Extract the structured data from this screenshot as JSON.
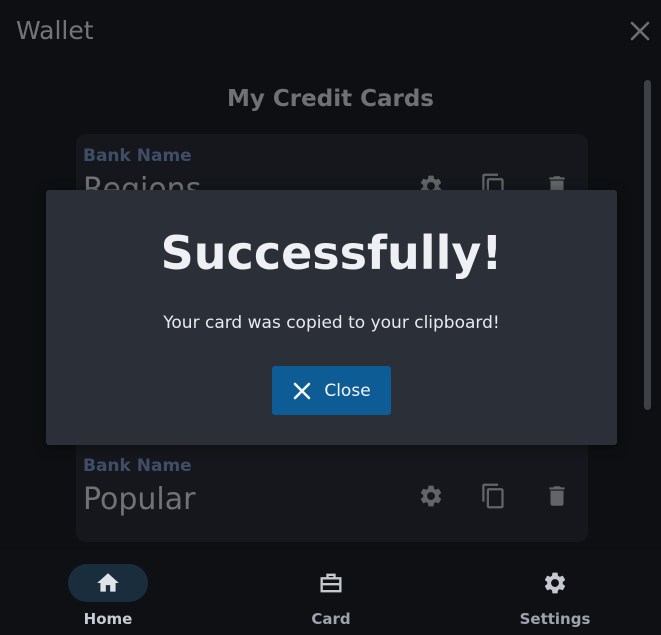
{
  "window": {
    "title": "Wallet",
    "close_icon": "close-icon"
  },
  "main": {
    "heading": "My Credit Cards"
  },
  "cards": [
    {
      "label": "Bank Name",
      "value": "Regions"
    },
    {
      "label": "Bank Name",
      "value": "Popular"
    }
  ],
  "modal": {
    "title": "Successfully!",
    "message": "Your card was copied to your clipboard!",
    "button_label": "Close"
  },
  "nav": {
    "items": [
      {
        "label": "Home",
        "icon": "home-icon",
        "active": true
      },
      {
        "label": "Card",
        "icon": "briefcase-icon",
        "active": false
      },
      {
        "label": "Settings",
        "icon": "gear-icon",
        "active": false
      }
    ]
  },
  "colors": {
    "accent": "#0d5c96",
    "bank_label": "#7e9ccc",
    "background": "#1b1e24",
    "card_bg": "#2a2f38"
  }
}
